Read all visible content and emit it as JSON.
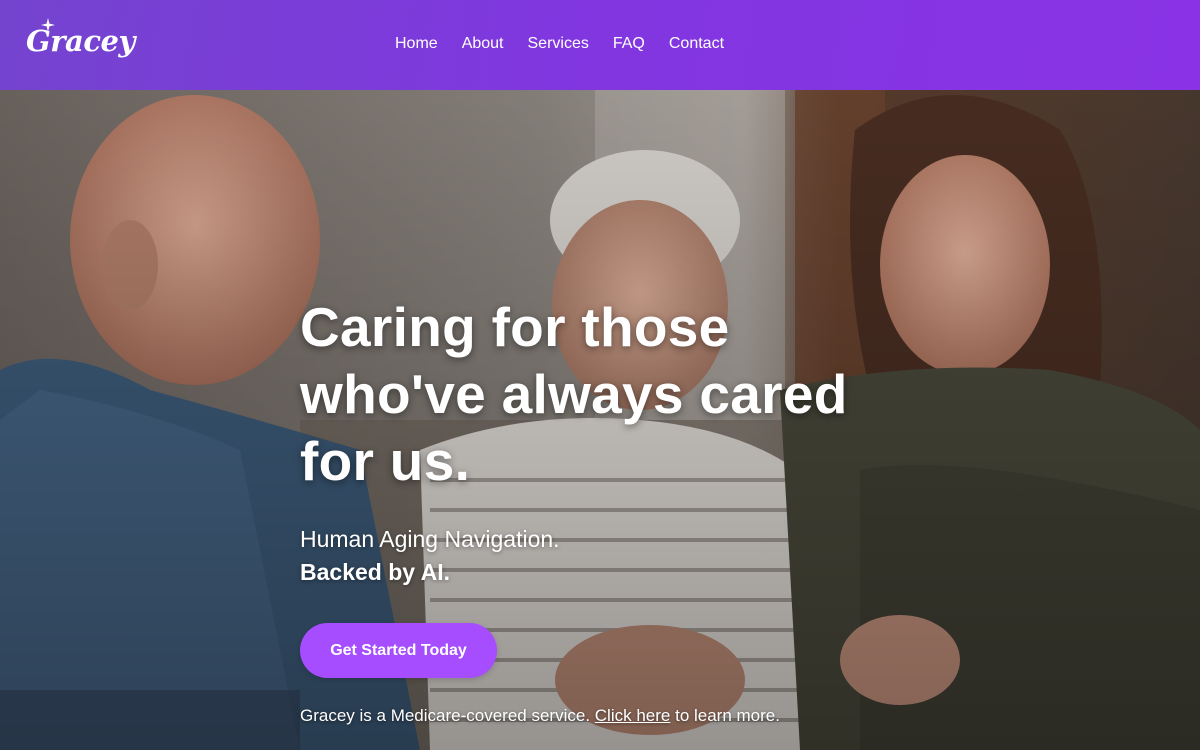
{
  "brand": {
    "logo_text": "Gracey",
    "logo_icon": "sparkle-icon"
  },
  "nav": {
    "items": [
      {
        "label": "Home"
      },
      {
        "label": "About"
      },
      {
        "label": "Services"
      },
      {
        "label": "FAQ"
      },
      {
        "label": "Contact"
      }
    ]
  },
  "hero": {
    "title": "Caring for those who've always cared for us.",
    "subtitle_line1": "Human Aging Navigation.",
    "subtitle_line2": "Backed by AI.",
    "cta_label": "Get Started Today",
    "footnote_before": "Gracey is a Medicare-covered service. ",
    "footnote_link": "Click here",
    "footnote_after": " to learn more."
  },
  "colors": {
    "header_start": "#7444cf",
    "header_end": "#8a33e6",
    "cta": "#a64dff",
    "text": "#ffffff"
  }
}
